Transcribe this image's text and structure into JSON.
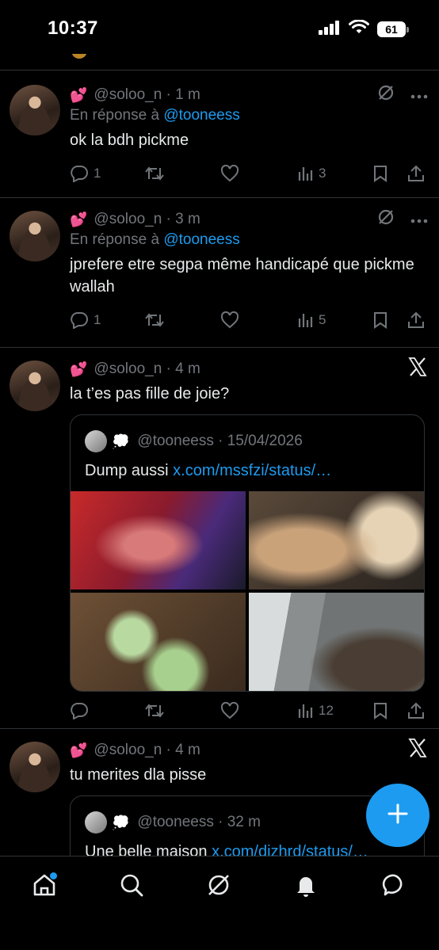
{
  "status_bar": {
    "time": "10:37",
    "battery": "61"
  },
  "tweets": [
    {
      "handle": "@soloo_n",
      "time": "· 1 m",
      "reply_prefix": "En réponse à",
      "reply_mention": "@tooneess",
      "text": "ok la bdh pickme",
      "replies": "1",
      "views": "3"
    },
    {
      "handle": "@soloo_n",
      "time": "· 3 m",
      "reply_prefix": "En réponse à",
      "reply_mention": "@tooneess",
      "text": "jprefere etre segpa même handicapé que pickme wallah",
      "replies": "1",
      "views": "5"
    },
    {
      "handle": "@soloo_n",
      "time": "· 4 m",
      "text": "la t’es pas fille de joie?",
      "quote": {
        "handle": "@tooneess",
        "time": "· 15/04/2026",
        "text": "Dump aussi",
        "link": "x.com/mssfzi/status/…"
      },
      "views": "12"
    },
    {
      "handle": "@soloo_n",
      "time": "· 4 m",
      "text": "tu merites dla pisse",
      "quote": {
        "handle": "@tooneess",
        "time": "· 32 m",
        "text": "Une belle maison",
        "link": "x.com/djzhrd/status/…"
      }
    }
  ],
  "colors": {
    "accent": "#1d9bf0",
    "secondary_text": "#71767b",
    "background": "#000000"
  }
}
